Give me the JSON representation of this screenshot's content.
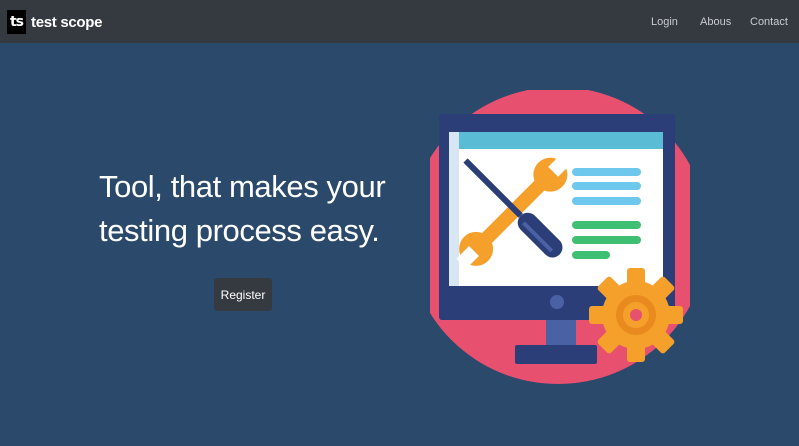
{
  "navbar": {
    "brand_mark": "ts",
    "brand_name": "test scope",
    "links": [
      {
        "label": "Login"
      },
      {
        "label": "Abous"
      },
      {
        "label": "Contact"
      }
    ]
  },
  "hero": {
    "title": "Tool, that makes your testing process easy.",
    "register_label": "Register"
  },
  "colors": {
    "background": "#2b4a6b",
    "navbar": "#353a40",
    "accent_pink": "#e8506f",
    "accent_orange": "#f5a02a",
    "monitor_navy": "#2c3e78"
  }
}
